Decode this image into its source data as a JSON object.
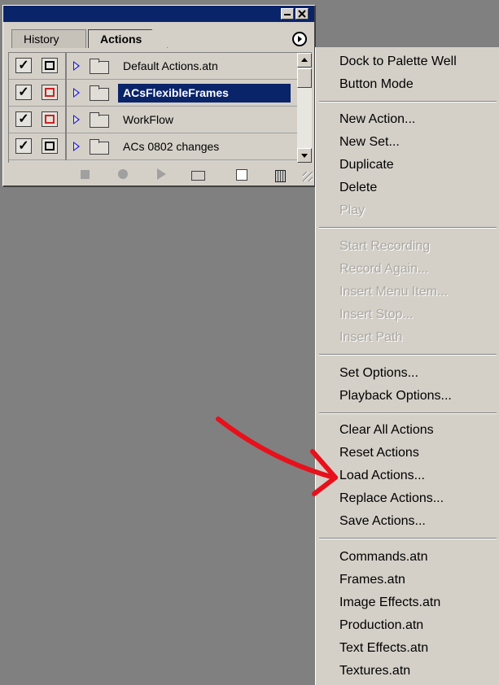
{
  "palette": {
    "tabs": [
      "History",
      "Actions"
    ],
    "active_tab": "Actions",
    "rows": [
      {
        "checked": true,
        "dialog_red": false,
        "label": "Default Actions.atn",
        "selected": false
      },
      {
        "checked": true,
        "dialog_red": true,
        "label": "ACsFlexibleFrames",
        "selected": true
      },
      {
        "checked": true,
        "dialog_red": true,
        "label": "WorkFlow",
        "selected": false
      },
      {
        "checked": true,
        "dialog_red": false,
        "label": "ACs 0802 changes",
        "selected": false
      }
    ]
  },
  "menu": {
    "groups": [
      [
        {
          "label": "Dock to Palette Well",
          "enabled": true
        },
        {
          "label": "Button Mode",
          "enabled": true
        }
      ],
      [
        {
          "label": "New Action...",
          "enabled": true
        },
        {
          "label": "New Set...",
          "enabled": true
        },
        {
          "label": "Duplicate",
          "enabled": true
        },
        {
          "label": "Delete",
          "enabled": true
        },
        {
          "label": "Play",
          "enabled": false
        }
      ],
      [
        {
          "label": "Start Recording",
          "enabled": false
        },
        {
          "label": "Record Again...",
          "enabled": false
        },
        {
          "label": "Insert Menu Item...",
          "enabled": false
        },
        {
          "label": "Insert Stop...",
          "enabled": false
        },
        {
          "label": "Insert Path",
          "enabled": false
        }
      ],
      [
        {
          "label": "Set Options...",
          "enabled": true
        },
        {
          "label": "Playback Options...",
          "enabled": true
        }
      ],
      [
        {
          "label": "Clear All Actions",
          "enabled": true
        },
        {
          "label": "Reset Actions",
          "enabled": true
        },
        {
          "label": "Load Actions...",
          "enabled": true
        },
        {
          "label": "Replace Actions...",
          "enabled": true
        },
        {
          "label": "Save Actions...",
          "enabled": true
        }
      ],
      [
        {
          "label": "Commands.atn",
          "enabled": true
        },
        {
          "label": "Frames.atn",
          "enabled": true
        },
        {
          "label": "Image Effects.atn",
          "enabled": true
        },
        {
          "label": "Production.atn",
          "enabled": true
        },
        {
          "label": "Text Effects.atn",
          "enabled": true
        },
        {
          "label": "Textures.atn",
          "enabled": true
        }
      ]
    ]
  },
  "annotation": {
    "color": "#e8101a",
    "points_to": "Load Actions..."
  },
  "colors": {
    "titlebar": "#0a246a",
    "selection": "#0a246a",
    "panel": "#d4d0c8",
    "desktop": "#808080"
  }
}
